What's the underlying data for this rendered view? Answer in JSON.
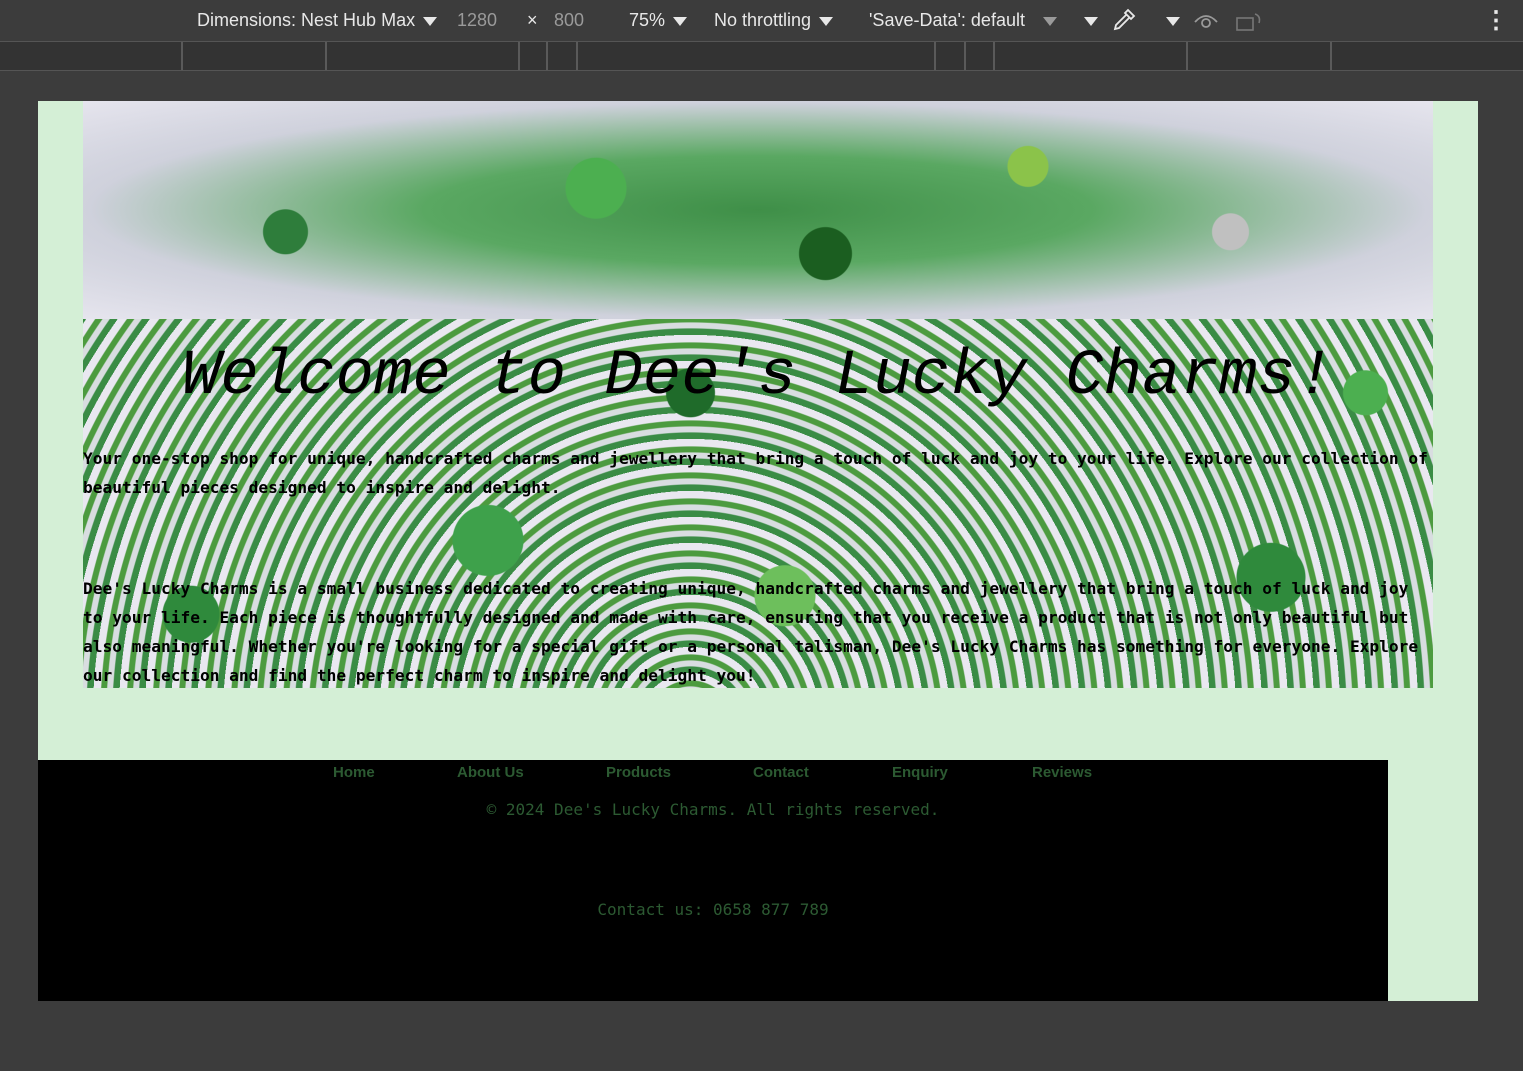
{
  "devtools": {
    "dimensions_label": "Dimensions: Nest Hub Max",
    "width": "1280",
    "times": "×",
    "height": "800",
    "zoom": "75%",
    "throttling": "No throttling",
    "save_data": "'Save-Data': default",
    "more_icon": "⋮"
  },
  "site": {
    "title": "Welcome to Dee's Lucky Charms!",
    "intro": "Your one-stop shop for unique, handcrafted charms and jewellery that bring a touch of luck and joy to your life. Explore our collection of beautiful pieces designed to inspire and delight.",
    "about": "Dee's Lucky Charms is a small business dedicated to creating unique, handcrafted charms and jewellery that bring a touch of luck and joy to your life. Each piece is thoughtfully designed and made with care, ensuring that you receive a product that is not only beautiful but also meaningful. Whether you're looking for a special gift or a personal talisman, Dee's Lucky Charms has something for everyone. Explore our collection and find the perfect charm to inspire and delight you!",
    "nav": [
      "Home",
      "About Us",
      "Products",
      "Contact",
      "Enquiry",
      "Reviews"
    ],
    "copyright": "© 2024 Dee's Lucky Charms. All rights reserved.",
    "contact": "Contact us: 0658 877 789"
  }
}
